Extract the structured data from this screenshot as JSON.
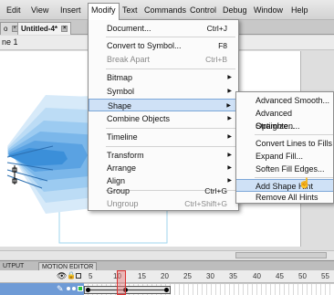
{
  "menubar": {
    "items": [
      "Edit",
      "View",
      "Insert",
      "Modify",
      "Text",
      "Commands",
      "Control",
      "Debug",
      "Window",
      "Help"
    ]
  },
  "tabs": [
    {
      "label": "o",
      "close": "×"
    },
    {
      "label": "Untitled-4*",
      "close": "×"
    }
  ],
  "scene": {
    "label": "ne 1"
  },
  "modify_menu": {
    "items": [
      {
        "label": "Document...",
        "shortcut": "Ctrl+J"
      },
      {
        "label": "Convert to Symbol...",
        "shortcut": "F8"
      },
      {
        "label": "Break Apart",
        "shortcut": "Ctrl+B",
        "disabled": true
      },
      {
        "label": "Bitmap",
        "submenu": true
      },
      {
        "label": "Symbol",
        "submenu": true
      },
      {
        "label": "Shape",
        "submenu": true,
        "highlighted": true
      },
      {
        "label": "Combine Objects",
        "submenu": true
      },
      {
        "label": "Timeline",
        "submenu": true
      },
      {
        "label": "Transform",
        "submenu": true
      },
      {
        "label": "Arrange",
        "submenu": true
      },
      {
        "label": "Align",
        "submenu": true
      },
      {
        "label": "Group",
        "shortcut": "Ctrl+G"
      },
      {
        "label": "Ungroup",
        "shortcut": "Ctrl+Shift+G",
        "disabled": true
      }
    ]
  },
  "shape_submenu": {
    "items": [
      {
        "label": "Advanced Smooth..."
      },
      {
        "label": "Advanced Straighten..."
      },
      {
        "label": "Optimize..."
      },
      {
        "label": "Convert Lines to Fills"
      },
      {
        "label": "Expand Fill..."
      },
      {
        "label": "Soften Fill Edges..."
      },
      {
        "label": "Add Shape Hint",
        "highlighted": true
      },
      {
        "label": "Remove All Hints"
      }
    ]
  },
  "timeline": {
    "tabs": [
      "UTPUT",
      "MOTION EDITOR"
    ],
    "frame_numbers": [
      "5",
      "10",
      "15",
      "20",
      "25",
      "30",
      "35",
      "40",
      "45",
      "50",
      "55"
    ],
    "current_frame": 10
  },
  "colors": {
    "menu_highlight": "#cfe1f6",
    "layer_selected": "#6f9bd6",
    "shape_light": "#c9e2f7",
    "shape_dark": "#2f8fd8",
    "playhead": "#d33333"
  }
}
